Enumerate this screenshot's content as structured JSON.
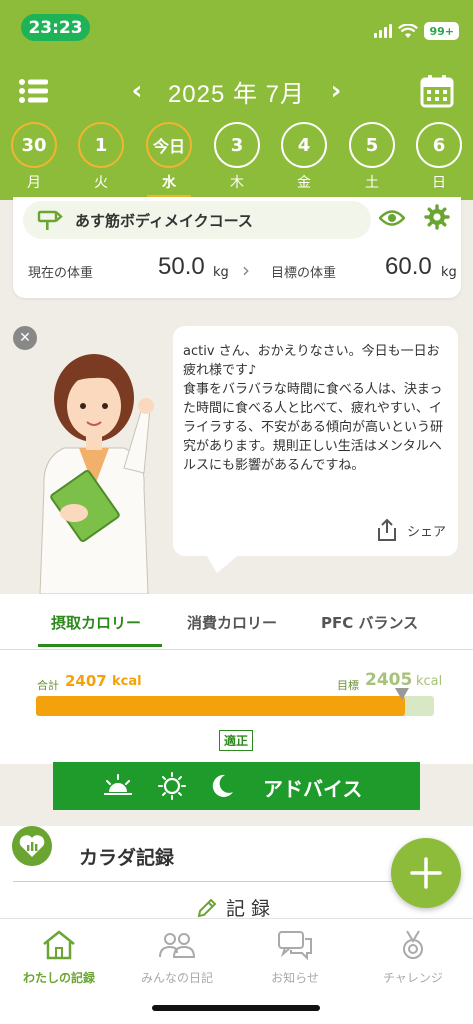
{
  "status_bar": {
    "time": "23:23",
    "battery": "99+"
  },
  "header": {
    "month": "2025 年 7月",
    "prev": "‹",
    "next": "›"
  },
  "days": [
    {
      "num": "30",
      "weekday": "月",
      "state": "past"
    },
    {
      "num": "1",
      "weekday": "火",
      "state": "past"
    },
    {
      "num": "今日",
      "weekday": "水",
      "state": "today"
    },
    {
      "num": "3",
      "weekday": "木",
      "state": "future"
    },
    {
      "num": "4",
      "weekday": "金",
      "state": "future"
    },
    {
      "num": "5",
      "weekday": "土",
      "state": "future"
    },
    {
      "num": "6",
      "weekday": "日",
      "state": "future"
    }
  ],
  "course": {
    "name": "あす筋ボディメイクコース",
    "current_label": "現在の体重",
    "current_value": "50.0",
    "current_unit": "kg",
    "goal_label": "目標の体重",
    "goal_value": "60.0",
    "goal_unit": "kg"
  },
  "advice": {
    "close": "✕",
    "message": "activ さん、おかえりなさい。今日も一日お疲れ様です♪\n食事をバラバラな時間に食べる人は、決まった時間に食べる人と比べて、疲れやすい、イライラする、不安がある傾向が高いという研究があります。規則正しい生活はメンタルヘルスにも影響があるんですね。",
    "share_label": "シェア"
  },
  "calorie": {
    "tabs": [
      "摂取カロリー",
      "消費カロリー",
      "PFC バランス"
    ],
    "active_tab": 0,
    "total_label": "合計",
    "total_value": "2407",
    "total_unit": "kcal",
    "goal_label": "目標",
    "goal_value": "2405",
    "goal_unit": "kcal",
    "progress_ratio": 0.927,
    "goal_marker_ratio": 0.92,
    "status": "適正"
  },
  "advice_button": {
    "label": "アドバイス"
  },
  "body_record": {
    "title": "カラダ記録",
    "record_label": "記 録"
  },
  "bottom_nav": [
    {
      "label": "わたしの記録",
      "active": true
    },
    {
      "label": "みんなの日記",
      "active": false
    },
    {
      "label": "お知らせ",
      "active": false
    },
    {
      "label": "チャレンジ",
      "active": false
    }
  ],
  "colors": {
    "brand_green": "#8dbb3a",
    "dark_green": "#1e9b2b",
    "orange": "#f3a20c",
    "ring_orange": "#f2b431"
  }
}
